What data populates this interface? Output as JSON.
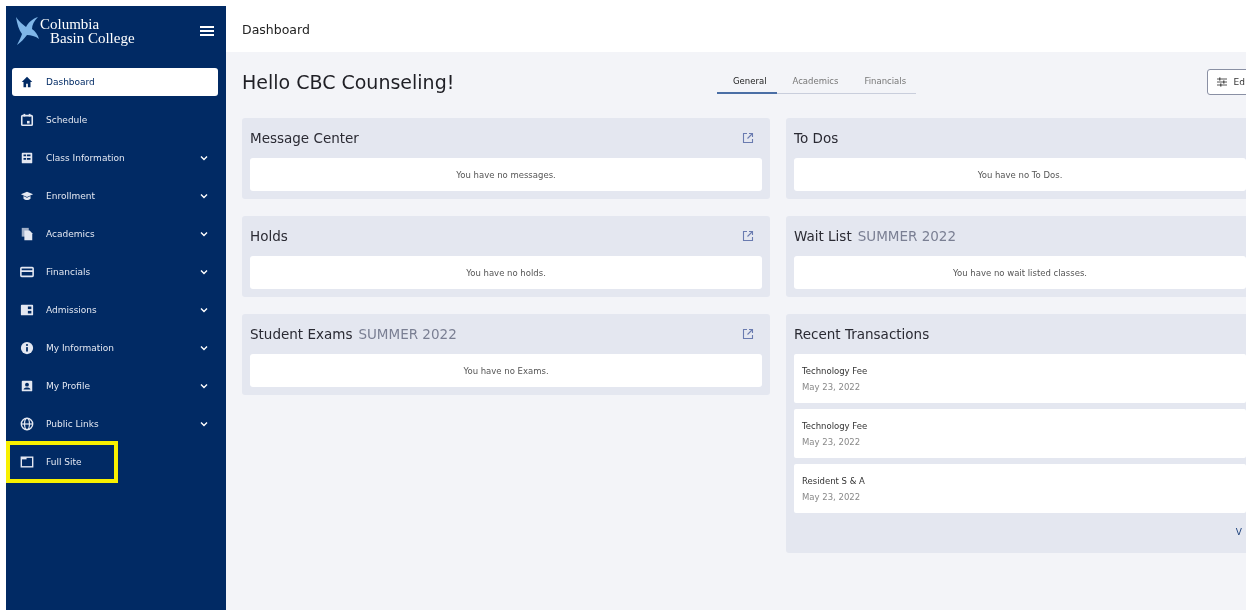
{
  "sidebar": {
    "logo": [
      "Columbia",
      "Basin College"
    ],
    "items": [
      {
        "label": "Dashboard",
        "expandable": false,
        "selected": true
      },
      {
        "label": "Schedule",
        "expandable": false,
        "selected": false
      },
      {
        "label": "Class Information",
        "expandable": true,
        "selected": false
      },
      {
        "label": "Enrollment",
        "expandable": true,
        "selected": false
      },
      {
        "label": "Academics",
        "expandable": true,
        "selected": false
      },
      {
        "label": "Financials",
        "expandable": true,
        "selected": false
      },
      {
        "label": "Admissions",
        "expandable": true,
        "selected": false
      },
      {
        "label": "My Information",
        "expandable": true,
        "selected": false
      },
      {
        "label": "My Profile",
        "expandable": true,
        "selected": false
      },
      {
        "label": "Public Links",
        "expandable": true,
        "selected": false
      },
      {
        "label": "Full Site",
        "expandable": false,
        "selected": false,
        "highlighted": true
      }
    ]
  },
  "header": {
    "title": "Dashboard"
  },
  "greeting": "Hello CBC Counseling!",
  "tabs": [
    {
      "label": "General",
      "selected": true
    },
    {
      "label": "Academics",
      "selected": false
    },
    {
      "label": "Financials",
      "selected": false
    }
  ],
  "edit_button": {
    "label": "Ed"
  },
  "columns": [
    [
      {
        "title": "Message Center",
        "link_icon": true,
        "empty_text": "You have no messages."
      },
      {
        "title": "Holds",
        "link_icon": true,
        "empty_text": "You have no holds."
      },
      {
        "title": "Student Exams",
        "term": "SUMMER 2022",
        "link_icon": true,
        "empty_text": "You have no Exams."
      }
    ],
    [
      {
        "title": "To Dos",
        "link_icon": false,
        "empty_text": "You have no To Dos."
      },
      {
        "title": "Wait List",
        "term": "SUMMER 2022",
        "link_icon": false,
        "empty_text": "You have no wait listed classes."
      },
      {
        "title": "Recent Transactions",
        "link_icon": false,
        "items": [
          {
            "name": "Technology Fee",
            "date": "May 23, 2022"
          },
          {
            "name": "Technology Fee",
            "date": "May 23, 2022"
          },
          {
            "name": "Resident S & A",
            "date": "May 23, 2022"
          }
        ],
        "footer_link": "V"
      }
    ]
  ]
}
